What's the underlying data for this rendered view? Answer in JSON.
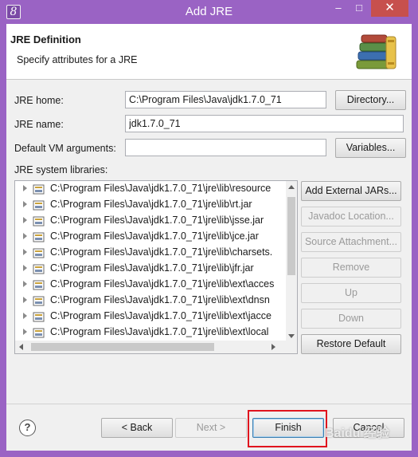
{
  "window": {
    "title": "Add JRE",
    "controls": {
      "minimize": "–",
      "maximize": "□",
      "close": "✕"
    },
    "accent": "#9a63c4"
  },
  "banner": {
    "title": "JRE Definition",
    "description": "Specify attributes for a JRE"
  },
  "form": {
    "jre_home_label": "JRE home:",
    "jre_home_value": "C:\\Program Files\\Java\\jdk1.7.0_71",
    "directory_button": "Directory...",
    "jre_name_label": "JRE name:",
    "jre_name_value": "jdk1.7.0_71",
    "vm_args_label": "Default VM arguments:",
    "vm_args_value": "",
    "variables_button": "Variables...",
    "libraries_label": "JRE system libraries:"
  },
  "libraries": [
    "C:\\Program Files\\Java\\jdk1.7.0_71\\jre\\lib\\resource",
    "C:\\Program Files\\Java\\jdk1.7.0_71\\jre\\lib\\rt.jar",
    "C:\\Program Files\\Java\\jdk1.7.0_71\\jre\\lib\\jsse.jar",
    "C:\\Program Files\\Java\\jdk1.7.0_71\\jre\\lib\\jce.jar",
    "C:\\Program Files\\Java\\jdk1.7.0_71\\jre\\lib\\charsets.",
    "C:\\Program Files\\Java\\jdk1.7.0_71\\jre\\lib\\jfr.jar",
    "C:\\Program Files\\Java\\jdk1.7.0_71\\jre\\lib\\ext\\acces",
    "C:\\Program Files\\Java\\jdk1.7.0_71\\jre\\lib\\ext\\dnsn",
    "C:\\Program Files\\Java\\jdk1.7.0_71\\jre\\lib\\ext\\jacce",
    "C:\\Program Files\\Java\\jdk1.7.0_71\\jre\\lib\\ext\\local"
  ],
  "side_buttons": {
    "add_external": "Add External JARs...",
    "javadoc": "Javadoc Location...",
    "source": "Source Attachment...",
    "remove": "Remove",
    "up": "Up",
    "down": "Down",
    "restore": "Restore Default"
  },
  "footer": {
    "help": "?",
    "back": "< Back",
    "next": "Next >",
    "finish": "Finish",
    "cancel": "Cancel",
    "highlight_color": "#e0141e"
  },
  "watermark": "Baidu 经验"
}
